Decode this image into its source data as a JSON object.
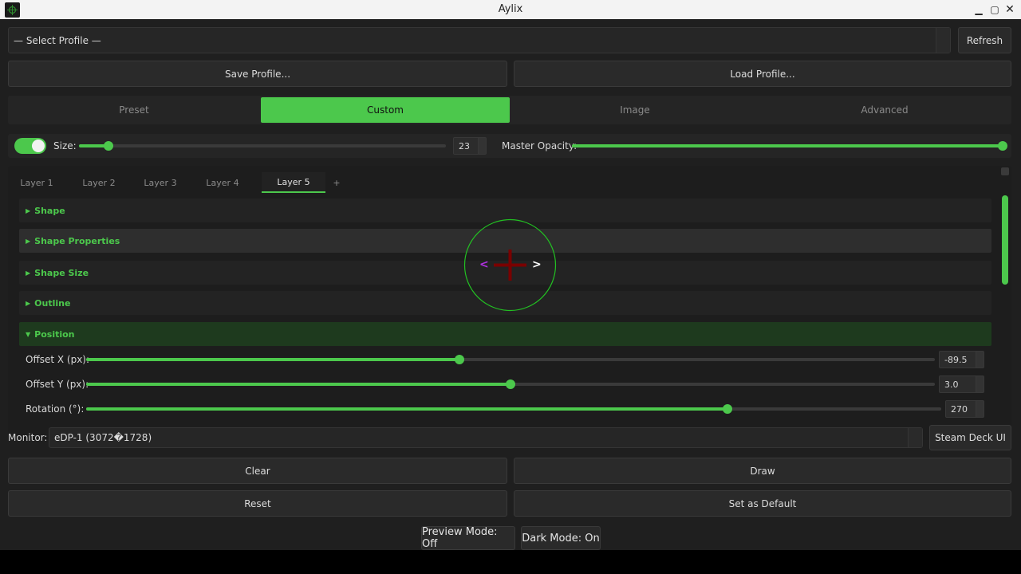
{
  "window": {
    "title": "Aylix"
  },
  "profile": {
    "selected": "— Select Profile —",
    "refresh_label": "Refresh",
    "save_label": "Save Profile...",
    "load_label": "Load Profile..."
  },
  "modes": {
    "tabs": [
      "Preset",
      "Custom",
      "Image",
      "Advanced"
    ],
    "active": "Custom"
  },
  "size_bar": {
    "enabled": true,
    "size_label": "Size:",
    "size_value": "23",
    "size_fraction": 0.08,
    "opacity_label": "Master Opacity:",
    "opacity_fraction": 1.0
  },
  "layers": {
    "tabs": [
      "Layer 1",
      "Layer 2",
      "Layer 3",
      "Layer 4",
      "Layer 5"
    ],
    "active": "Layer 5",
    "add_label": "+"
  },
  "sections": [
    {
      "label": "Shape",
      "expanded": false
    },
    {
      "label": "Shape Properties",
      "expanded": false
    },
    {
      "label": "Shape Size",
      "expanded": false
    },
    {
      "label": "Outline",
      "expanded": false
    },
    {
      "label": "Position",
      "expanded": true
    }
  ],
  "position": {
    "rows": [
      {
        "label": "Offset X (px):",
        "value": "-89.5",
        "fraction": 0.44
      },
      {
        "label": "Offset Y (px):",
        "value": "3.0",
        "fraction": 0.5
      },
      {
        "label": "Rotation (°):",
        "value": "270",
        "fraction": 0.75
      }
    ]
  },
  "preview": {
    "left_arrow": "<",
    "right_arrow": ">"
  },
  "monitor": {
    "label": "Monitor:",
    "value": "eDP-1 (3072�1728)",
    "steam_label": "Steam Deck UI"
  },
  "actions": {
    "clear": "Clear",
    "draw": "Draw",
    "reset": "Reset",
    "set_default": "Set as Default"
  },
  "toggles": {
    "preview_mode": "Preview Mode: Off",
    "dark_mode": "Dark Mode: On"
  },
  "colors": {
    "accent": "#4cc84c",
    "background": "#1f1f1f"
  }
}
